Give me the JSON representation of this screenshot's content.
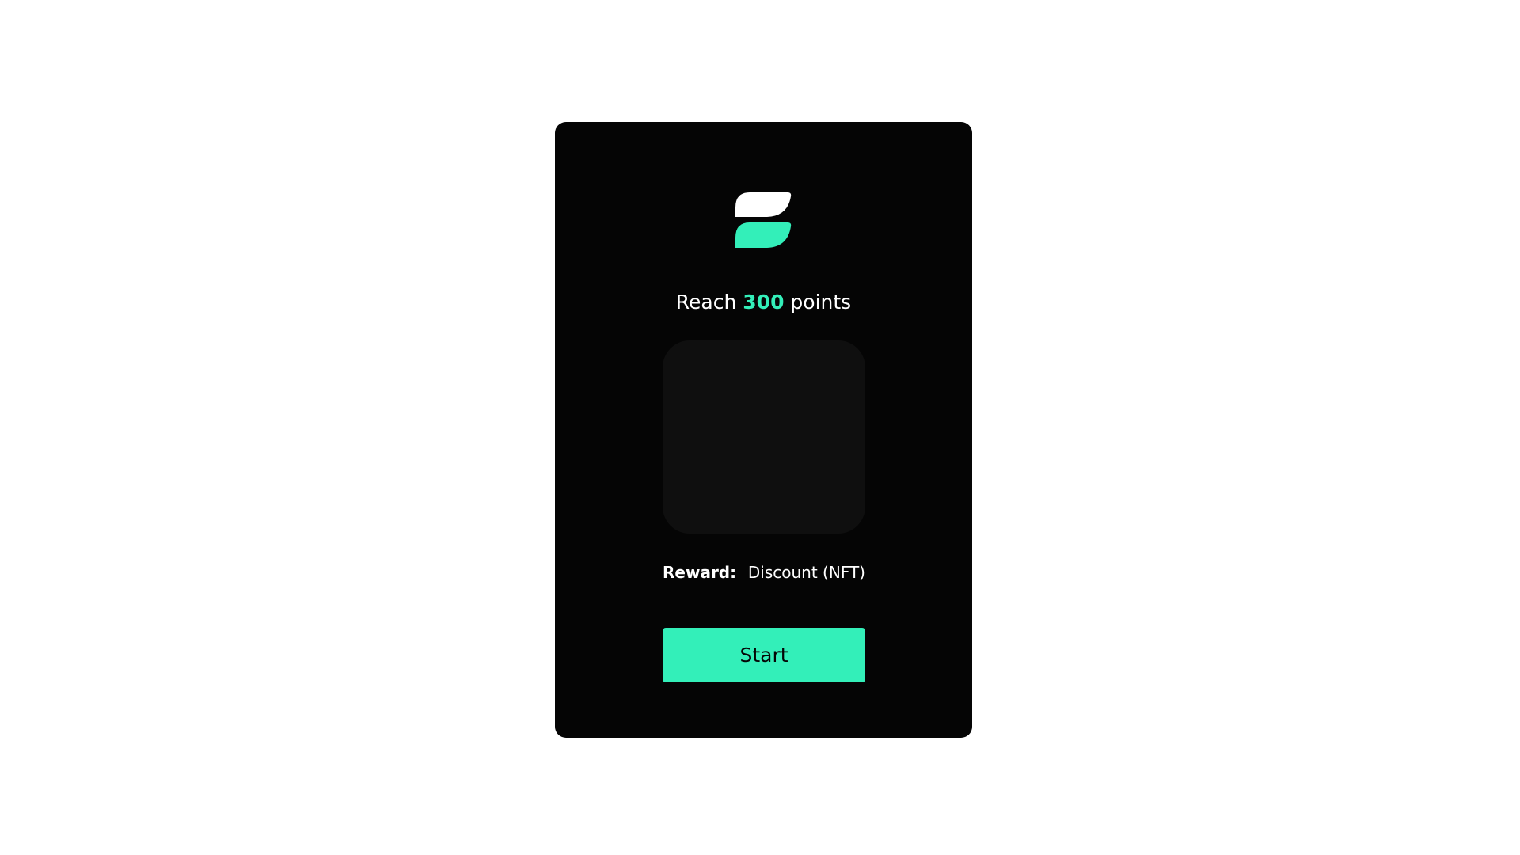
{
  "colors": {
    "page_background": "#ffffff",
    "card_background": "#050505",
    "image_placeholder": "#0f0f0f",
    "accent": "#33efb9",
    "text": "#ffffff",
    "button_text": "#050505"
  },
  "logo": {
    "icon": "brand-logo-icon"
  },
  "challenge": {
    "title_prefix": "Reach",
    "points": "300",
    "title_suffix": "points"
  },
  "reward": {
    "label": "Reward:",
    "value": "Discount (NFT)"
  },
  "actions": {
    "start_label": "Start"
  }
}
